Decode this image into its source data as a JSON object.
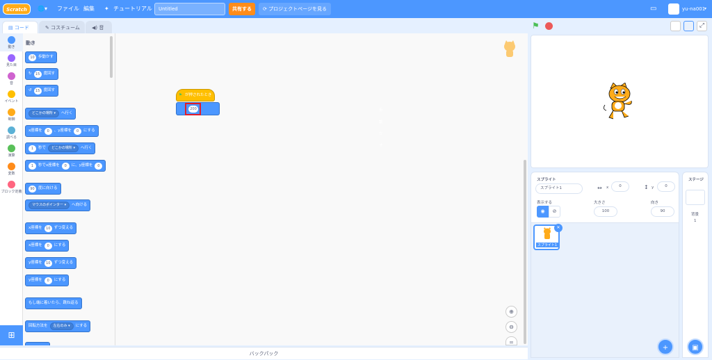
{
  "menu": {
    "logo": "Scratch",
    "file": "ファイル",
    "edit": "編集",
    "tutorial": "チュートリアル",
    "title_value": "Untitled",
    "share": "共有する",
    "project_page": "プロジェクトページを見る",
    "username": "yu-na001"
  },
  "tabs": {
    "code": "コード",
    "costume": "コスチューム",
    "sound": "音"
  },
  "categories": [
    {
      "label": "動き",
      "color": "#4c97ff"
    },
    {
      "label": "見た目",
      "color": "#9966ff"
    },
    {
      "label": "音",
      "color": "#cf63cf"
    },
    {
      "label": "イベント",
      "color": "#ffbf00"
    },
    {
      "label": "制御",
      "color": "#ffab19"
    },
    {
      "label": "調べる",
      "color": "#5cb1d6"
    },
    {
      "label": "演算",
      "color": "#59c059"
    },
    {
      "label": "変数",
      "color": "#ff8c1a"
    },
    {
      "label": "ブロック定義",
      "color": "#ff6680"
    }
  ],
  "palette": {
    "title": "動き",
    "move_val": "10",
    "move_lbl": "歩動かす",
    "turn_r_val": "15",
    "turn_r_lbl": "度回す",
    "turn_l_val": "15",
    "turn_l_lbl": "度回す",
    "goto_dd": "どこかの場所 ▾",
    "goto_lbl": "へ行く",
    "gxy_a": "x座標を",
    "gxy_x": "0",
    "gxy_b": "、y座標を",
    "gxy_y": "0",
    "gxy_c": "にする",
    "glide_val": "1",
    "glide_a": "秒で",
    "glide_dd": "どこかの場所 ▾",
    "glide_b": "へ行く",
    "glidexy_val": "1",
    "glidexy_a": "秒でx座標を",
    "glidexy_x": "0",
    "glidexy_b": "に、y座標を",
    "glidexy_y": "0",
    "dir_val": "90",
    "dir_lbl": "度に向ける",
    "point_dd": "マウスのポインター ▾",
    "point_lbl": "へ向ける",
    "chx_a": "x座標を",
    "chx_v": "10",
    "chx_b": "ずつ変える",
    "setx_a": "x座標を",
    "setx_v": "0",
    "setx_b": "にする",
    "chy_a": "y座標を",
    "chy_v": "10",
    "chy_b": "ずつ変える",
    "sety_a": "y座標を",
    "sety_v": "0",
    "sety_b": "にする",
    "bounce": "もし端に着いたら、跳ね返る",
    "rot_a": "回転方法を",
    "rot_dd": "左右のみ ▾",
    "rot_b": "にする"
  },
  "script": {
    "hat_label": "が押されたとき",
    "move_value": "200",
    "move_label": "歩動かす"
  },
  "backpack": "バックパック",
  "sprite_info": {
    "title": "スプライト",
    "name": "スプライト1",
    "x_label": "x",
    "x_value": "0",
    "y_label": "y",
    "y_value": "0",
    "show_label": "表示する",
    "size_label": "大きさ",
    "size_value": "100",
    "direction_label": "向き",
    "direction_value": "90"
  },
  "sprite_tile": {
    "name": "スプライト1"
  },
  "stage_pane": {
    "title": "ステージ",
    "backdrop_label": "背景",
    "backdrop_count": "1"
  }
}
